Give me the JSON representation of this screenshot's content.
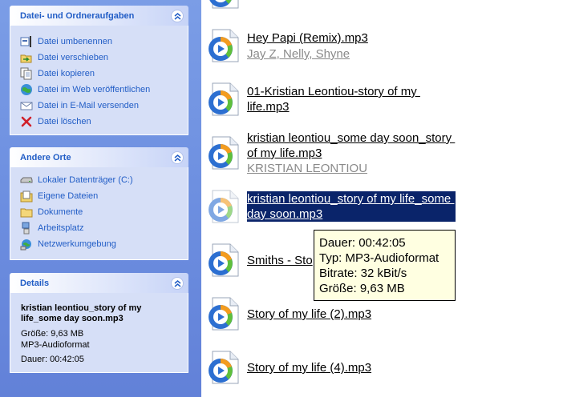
{
  "file_tasks": {
    "title": "Datei- und Ordneraufgaben",
    "items": [
      {
        "label": "Datei umbenennen",
        "icon": "rename-icon"
      },
      {
        "label": "Datei verschieben",
        "icon": "move-icon"
      },
      {
        "label": "Datei kopieren",
        "icon": "copy-icon"
      },
      {
        "label": "Datei im Web veröffentlichen",
        "icon": "publish-web-icon"
      },
      {
        "label": "Datei in E-Mail versenden",
        "icon": "email-icon"
      },
      {
        "label": "Datei löschen",
        "icon": "delete-icon"
      }
    ]
  },
  "other_places": {
    "title": "Andere Orte",
    "items": [
      {
        "label": "Lokaler Datenträger (C:)",
        "icon": "drive-icon"
      },
      {
        "label": "Eigene Dateien",
        "icon": "my-documents-icon"
      },
      {
        "label": "Dokumente",
        "icon": "folder-icon"
      },
      {
        "label": "Arbeitsplatz",
        "icon": "my-computer-icon"
      },
      {
        "label": "Netzwerkumgebung",
        "icon": "network-icon"
      }
    ]
  },
  "details": {
    "title": "Details",
    "name": "kristian leontiou_story of my life_some day soon.mp3",
    "size": "Größe: 9,63 MB",
    "type": "MP3-Audioformat",
    "duration": "Dauer: 00:42:05"
  },
  "files": [
    {
      "name": "Hey Papi (Remix).mp3",
      "artist": "Jay Z, Nelly, Shyne"
    },
    {
      "name": "01-Kristian Leontiou-story of my \nlife.mp3",
      "artist": ""
    },
    {
      "name": "kristian leontiou_some day soon_story \nof my life.mp3",
      "artist": "KRISTIAN LEONTIOU"
    },
    {
      "name": "kristian leontiou_story of my life_some \nday soon.mp3",
      "artist": "",
      "selected": true
    },
    {
      "name": "Smiths - Sto",
      "artist": ""
    },
    {
      "name": "Story of my life (2).mp3",
      "artist": ""
    },
    {
      "name": "Story of my life (4).mp3",
      "artist": ""
    }
  ],
  "tooltip": {
    "duration": "Dauer: 00:42:05",
    "type": "Typ: MP3-Audioformat",
    "bitrate": "Bitrate: 32 kBit/s",
    "size": "Größe: 9,63 MB"
  },
  "colors": {
    "pane_background": "#6d8fe0",
    "panel_title": "#215dc6",
    "panel_body": "#d6dff7",
    "selection": "#0a246a",
    "tooltip_background": "#ffffe1"
  }
}
